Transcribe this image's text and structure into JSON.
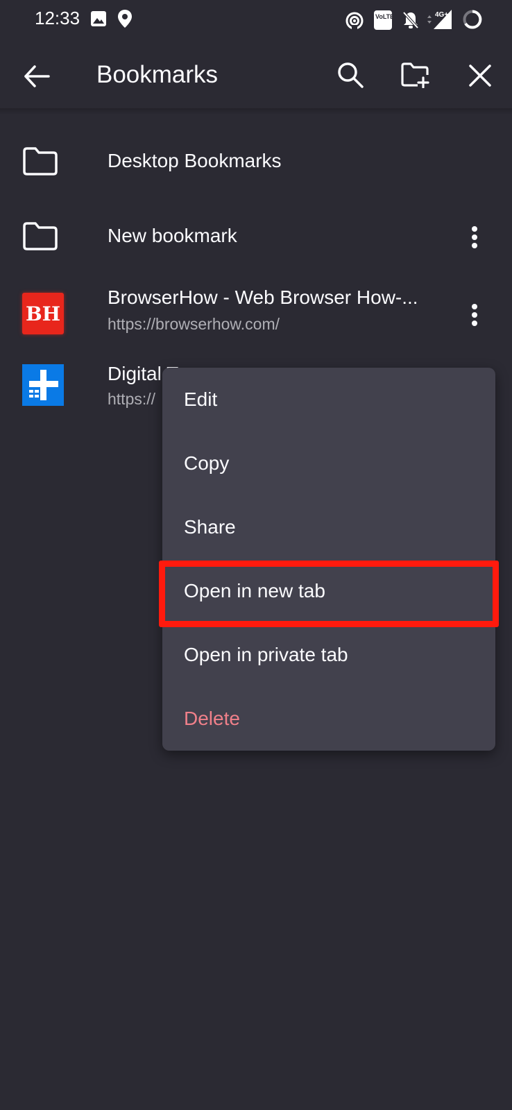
{
  "status_bar": {
    "time": "12:33",
    "icons": [
      "image-icon",
      "location-pin-icon",
      "hotspot-icon",
      "volte-icon",
      "bell-off-icon",
      "signal-4g-icon",
      "battery-ring-icon"
    ],
    "volte_text": "VoLTE",
    "network_text": "4G+"
  },
  "toolbar": {
    "title": "Bookmarks",
    "icons": [
      "back-arrow-icon",
      "search-icon",
      "new-folder-icon",
      "close-icon"
    ]
  },
  "bookmarks": [
    {
      "type": "folder",
      "title": "Desktop Bookmarks"
    },
    {
      "type": "folder",
      "title": "New bookmark"
    },
    {
      "type": "site",
      "title": "BrowserHow - Web Browser How-...",
      "url": "https://browserhow.com/",
      "favicon_text": "BH"
    },
    {
      "type": "site",
      "title": "Digital T",
      "url": "https://"
    }
  ],
  "context_menu": {
    "items": [
      {
        "label": "Edit"
      },
      {
        "label": "Copy"
      },
      {
        "label": "Share"
      },
      {
        "label": "Open in new tab"
      },
      {
        "label": "Open in private tab"
      },
      {
        "label": "Delete"
      }
    ]
  },
  "colors": {
    "background": "#2b2a33",
    "menu": "#42414d",
    "text": "#fbfbfe",
    "delete": "#f0808a",
    "highlight": "#ff1a0d"
  }
}
